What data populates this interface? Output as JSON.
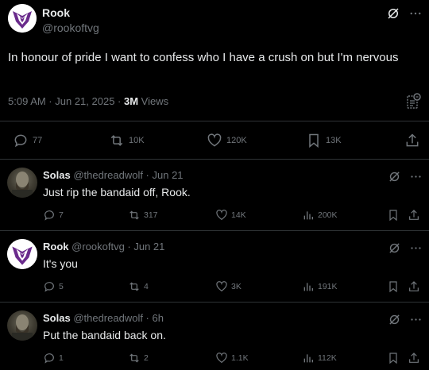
{
  "main": {
    "name": "Rook",
    "handle": "@rookoftvg",
    "text": "In honour of pride I want to confess who I have a crush on but I'm nervous",
    "timestamp": "5:09 AM · Jun 21, 2025 · ",
    "views_count": "3M",
    "views_label": " Views",
    "replies": "77",
    "reposts": "10K",
    "likes": "120K",
    "bookmarks": "13K"
  },
  "replies": [
    {
      "name": "Solas",
      "handle": "@thedreadwolf · Jun 21",
      "text": "Just rip the bandaid off, Rook.",
      "replies": "7",
      "reposts": "317",
      "likes": "14K",
      "views": "200K",
      "avatar": "solas"
    },
    {
      "name": "Rook",
      "handle": "@rookoftvg · Jun 21",
      "text": "It's you",
      "replies": "5",
      "reposts": "4",
      "likes": "3K",
      "views": "191K",
      "avatar": "rook"
    },
    {
      "name": "Solas",
      "handle": "@thedreadwolf · 6h",
      "text": "Put the bandaid back on.",
      "replies": "1",
      "reposts": "2",
      "likes": "1.1K",
      "views": "112K",
      "avatar": "solas"
    }
  ],
  "colors": {
    "background": "#000000",
    "text": "#e7e9ea",
    "muted": "#71767b",
    "divider": "#2f3336",
    "logo_purple": "#6a2b8c"
  }
}
